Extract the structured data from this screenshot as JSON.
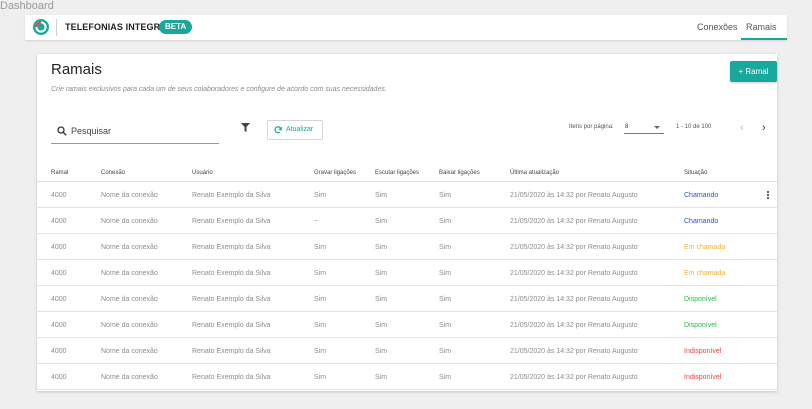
{
  "breadcrumb": "Dashboard",
  "app": {
    "title": "TELEFONIAS INTEGRADAS",
    "badge": "BETA",
    "accent": "#18a89c"
  },
  "nav": {
    "tabs": [
      "Conexões",
      "Ramais"
    ],
    "active": "Ramais"
  },
  "page": {
    "title": "Ramais",
    "subtitle": "Crie ramais exclusivos para cada um de seus colaboradores e configure de acordo com suas necessidades.",
    "add_label": "+ Ramal"
  },
  "toolbar": {
    "search_placeholder": "Pesquisar",
    "filter_icon": "filter-icon",
    "refresh_label": "Atualizar",
    "per_page_label": "Itens por página:",
    "per_page_value": "8",
    "range": "1 - 10 de 100"
  },
  "table": {
    "columns": [
      "Ramal",
      "Conexão",
      "Usuário",
      "Gravar ligações",
      "Escutar ligações",
      "Baixar ligações",
      "Última atualização",
      "Situação"
    ],
    "rows": [
      [
        "4000",
        "Nome da conexão",
        "Renato Exemplo da Silva",
        "Sim",
        "Sim",
        "Sim",
        "21/05/2020 às 14:32 por Renato Augusto",
        "Chamando"
      ],
      [
        "4000",
        "Nome da conexão",
        "Renato Exemplo da Silva",
        "--",
        "Sim",
        "Sim",
        "21/05/2020 às 14:32 por Renato Augusto",
        "Chamando"
      ],
      [
        "4000",
        "Nome da conexão",
        "Renato Exemplo da Silva",
        "Sim",
        "Sim",
        "Sim",
        "21/05/2020 às 14:32 por Renato Augusto",
        "Em chamada"
      ],
      [
        "4000",
        "Nome da conexão",
        "Renato Exemplo da Silva",
        "Sim",
        "Sim",
        "Sim",
        "21/05/2020 às 14:32 por Renato Augusto",
        "Em chamada"
      ],
      [
        "4000",
        "Nome da conexão",
        "Renato Exemplo da Silva",
        "Sim",
        "Sim",
        "Sim",
        "21/05/2020 às 14:32 por Renato Augusto",
        "Disponível"
      ],
      [
        "4000",
        "Nome da conexão",
        "Renato Exemplo da Silva",
        "Sim",
        "Sim",
        "Sim",
        "21/05/2020 às 14:32 por Renato Augusto",
        "Disponível"
      ],
      [
        "4000",
        "Nome da conexão",
        "Renato Exemplo da Silva",
        "Sim",
        "Sim",
        "Sim",
        "21/05/2020 às 14:32 por Renato Augusto",
        "Indisponível"
      ],
      [
        "4000",
        "Nome da conexão",
        "Renato Exemplo da Silva",
        "Sim",
        "Sim",
        "Sim",
        "21/05/2020 às 14:32 por Renato Augusto",
        "Indisponível"
      ]
    ],
    "status_colors": {
      "Chamando": "#2f4fd6",
      "Em chamada": "#f2b233",
      "Disponível": "#2db84a",
      "Indisponível": "#e8453c"
    }
  }
}
